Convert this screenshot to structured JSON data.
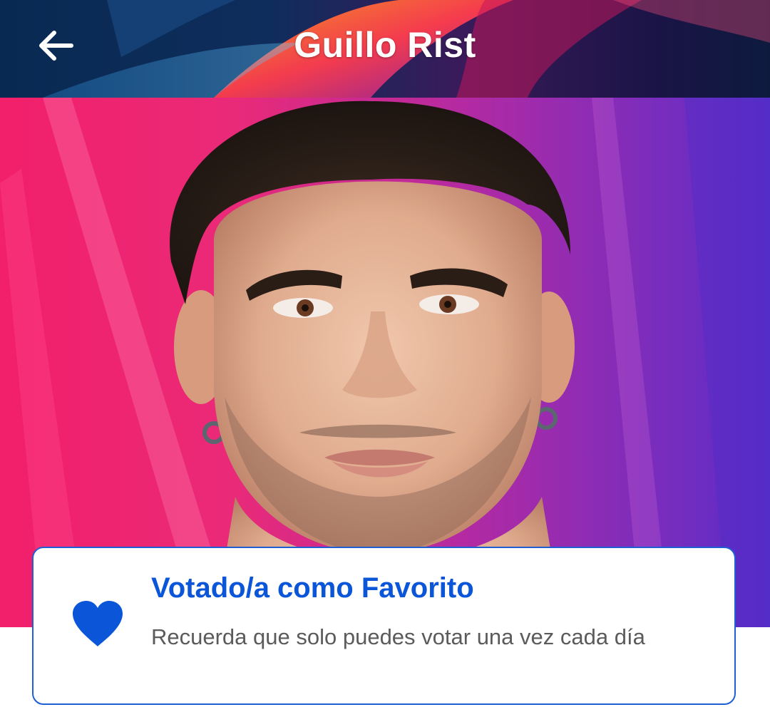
{
  "header": {
    "title": "Guillo Rist",
    "back_icon": "arrow-left-icon"
  },
  "hero": {
    "photo": "contestant-portrait",
    "colors": {
      "pink": "#f0266e",
      "purple": "#8a2fb8",
      "blue": "#5a2fd0"
    }
  },
  "vote_card": {
    "icon": "heart-icon",
    "title": "Votado/a como Favorito",
    "subtitle": "Recuerda que solo puedes votar una vez cada día",
    "colors": {
      "accent": "#0a55d8",
      "border": "#1f5fd6",
      "text": "#5b5b5b"
    }
  }
}
